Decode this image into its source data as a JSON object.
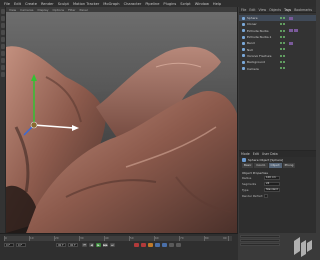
{
  "menubar": {
    "items": [
      "File",
      "Edit",
      "Create",
      "Render",
      "Sculpt",
      "Motion Tracker",
      "MoGraph",
      "Character",
      "Pipeline",
      "Plugins",
      "Script",
      "Window",
      "Help"
    ]
  },
  "viewport": {
    "header_items": [
      "View",
      "Cameras",
      "Display",
      "Options",
      "Filter",
      "Panel"
    ],
    "colors": {
      "sky": "#6e6e6e",
      "rock_main": "#8c5a4c",
      "rock_light": "#b98676",
      "rock_dark": "#3f2a25",
      "axis_y": "#33c233",
      "axis_x": "#ffffff",
      "axis_z": "#3a6ad8"
    }
  },
  "object_manager": {
    "tabs": [
      "File",
      "Edit",
      "View",
      "Objects",
      "Tags",
      "Bookmarks"
    ],
    "objects": [
      {
        "name": "Sphere"
      },
      {
        "name": "Cloner"
      },
      {
        "name": "Extrude Nurbs"
      },
      {
        "name": "Extrude Nurbs.1"
      },
      {
        "name": "Bend"
      },
      {
        "name": "Null"
      },
      {
        "name": "Voronoi Fracture"
      },
      {
        "name": "Background"
      },
      {
        "name": "Camera"
      }
    ]
  },
  "attribute_manager": {
    "tabs": [
      "Mode",
      "Edit",
      "User Data"
    ],
    "title": "Sphere Object [Sphere]",
    "subtabs": [
      "Basic",
      "Coord.",
      "Object",
      "Phong"
    ],
    "section": "Object Properties",
    "fields": [
      {
        "label": "Radius",
        "value": "100 cm"
      },
      {
        "label": "Segments",
        "value": "24"
      },
      {
        "label": "Type",
        "value": "Standard"
      },
      {
        "label": "Render Perfect",
        "value": ""
      }
    ]
  },
  "timeline": {
    "tick_labels": [
      "0",
      "10",
      "20",
      "30",
      "40",
      "50",
      "60",
      "70",
      "80",
      "90"
    ],
    "start_frame": "0 F",
    "current_frame": "0 F",
    "end_frame": "90 F",
    "max_frame": "90 F",
    "transport": [
      "⏮",
      "◀",
      "▶",
      "▶▶",
      "⏭"
    ]
  },
  "watermark": {
    "icon": "watermark-logo-icon"
  }
}
